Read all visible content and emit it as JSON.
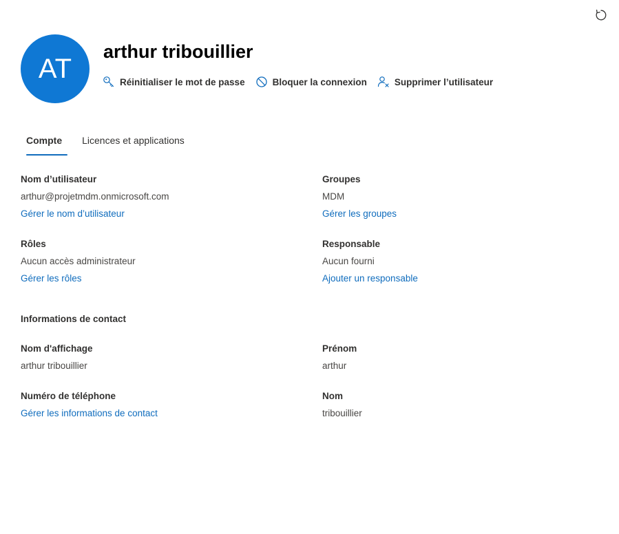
{
  "header": {
    "avatar_initials": "AT",
    "avatar_color": "#0f78d4",
    "user_name": "arthur tribouillier",
    "refresh_icon": "refresh-icon"
  },
  "actions": [
    {
      "label": "Réinitialiser le mot de passe",
      "icon": "key-icon"
    },
    {
      "label": "Bloquer la connexion",
      "icon": "block-icon"
    },
    {
      "label": "Supprimer l’utilisateur",
      "icon": "delete-user-icon"
    }
  ],
  "tabs": [
    {
      "label": "Compte",
      "active": true
    },
    {
      "label": "Licences et applications",
      "active": false
    }
  ],
  "account": {
    "username": {
      "title": "Nom d’utilisateur",
      "value": "arthur@projetmdm.onmicrosoft.com",
      "link": "Gérer le nom d’utilisateur"
    },
    "groups": {
      "title": "Groupes",
      "value": "MDM",
      "link": "Gérer les groupes"
    },
    "roles": {
      "title": "Rôles",
      "value": "Aucun accès administrateur",
      "link": "Gérer les rôles"
    },
    "manager": {
      "title": "Responsable",
      "value": "Aucun fourni",
      "link": "Ajouter un responsable"
    }
  },
  "contact": {
    "section_title": "Informations de contact",
    "display_name": {
      "title": "Nom d'affichage",
      "value": "arthur tribouillier"
    },
    "first_name": {
      "title": "Prénom",
      "value": "arthur"
    },
    "phone": {
      "title": "Numéro de téléphone",
      "link": "Gérer les informations de contact"
    },
    "last_name": {
      "title": "Nom",
      "value": "tribouillier"
    }
  },
  "colors": {
    "link": "#0f6cbd",
    "accent": "#0f78d4",
    "text": "#323130"
  }
}
